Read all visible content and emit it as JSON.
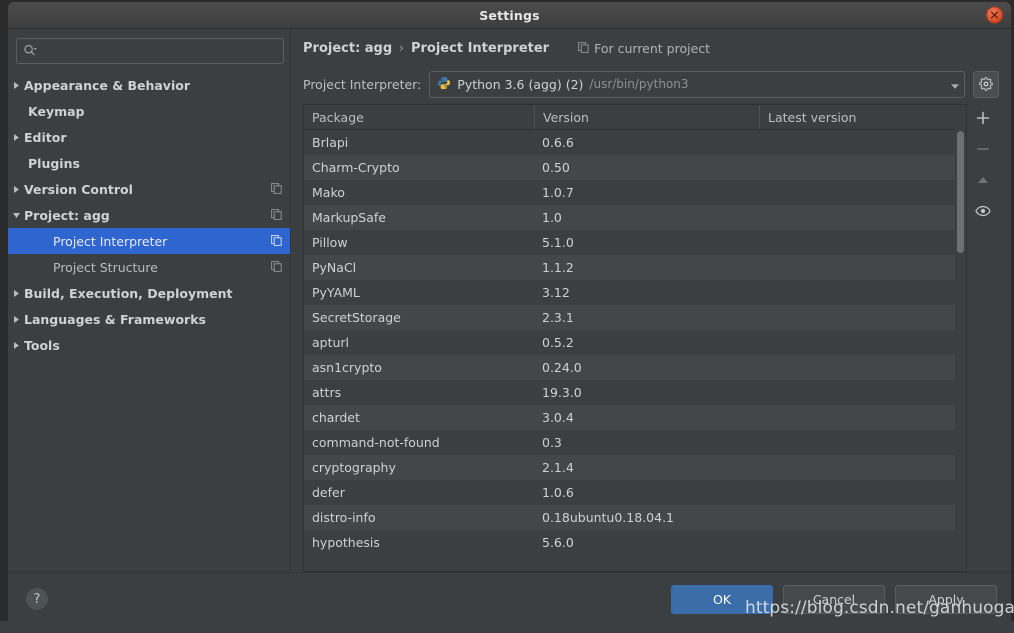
{
  "window": {
    "title": "Settings",
    "close_icon": "close-icon"
  },
  "sidebar": {
    "search": {
      "placeholder": "",
      "value": "",
      "icon": "search-icon"
    },
    "items": [
      {
        "label": "Appearance & Behavior",
        "arrow": "▶",
        "indent": 0,
        "bold": true,
        "selected": false,
        "copy": false
      },
      {
        "label": "Keymap",
        "arrow": "",
        "indent": 1,
        "bold": true,
        "selected": false,
        "copy": false
      },
      {
        "label": "Editor",
        "arrow": "▶",
        "indent": 0,
        "bold": true,
        "selected": false,
        "copy": false
      },
      {
        "label": "Plugins",
        "arrow": "",
        "indent": 1,
        "bold": true,
        "selected": false,
        "copy": false
      },
      {
        "label": "Version Control",
        "arrow": "▶",
        "indent": 0,
        "bold": true,
        "selected": false,
        "copy": true
      },
      {
        "label": "Project: agg",
        "arrow": "▼",
        "indent": 0,
        "bold": true,
        "selected": false,
        "copy": true
      },
      {
        "label": "Project Interpreter",
        "arrow": "",
        "indent": 2,
        "bold": false,
        "selected": true,
        "copy": true
      },
      {
        "label": "Project Structure",
        "arrow": "",
        "indent": 2,
        "bold": false,
        "selected": false,
        "copy": true
      },
      {
        "label": "Build, Execution, Deployment",
        "arrow": "▶",
        "indent": 0,
        "bold": true,
        "selected": false,
        "copy": false
      },
      {
        "label": "Languages & Frameworks",
        "arrow": "▶",
        "indent": 0,
        "bold": true,
        "selected": false,
        "copy": false
      },
      {
        "label": "Tools",
        "arrow": "▶",
        "indent": 0,
        "bold": true,
        "selected": false,
        "copy": false
      }
    ]
  },
  "main": {
    "breadcrumb": {
      "root": "Project: agg",
      "separator": "›",
      "current": "Project Interpreter"
    },
    "scope_note": {
      "label": "For current project",
      "icon": "copy-icon"
    },
    "interpreter": {
      "label": "Project Interpreter:",
      "icon": "python-icon",
      "name": "Python 3.6 (agg) (2)",
      "path": "/usr/bin/python3",
      "caret_icon": "chevron-down-icon",
      "settings_icon": "gear-icon"
    },
    "table": {
      "columns": [
        "Package",
        "Version",
        "Latest version"
      ],
      "rows": [
        {
          "package": "Brlapi",
          "version": "0.6.6",
          "latest": ""
        },
        {
          "package": "Charm-Crypto",
          "version": "0.50",
          "latest": ""
        },
        {
          "package": "Mako",
          "version": "1.0.7",
          "latest": ""
        },
        {
          "package": "MarkupSafe",
          "version": "1.0",
          "latest": ""
        },
        {
          "package": "Pillow",
          "version": "5.1.0",
          "latest": ""
        },
        {
          "package": "PyNaCl",
          "version": "1.1.2",
          "latest": ""
        },
        {
          "package": "PyYAML",
          "version": "3.12",
          "latest": ""
        },
        {
          "package": "SecretStorage",
          "version": "2.3.1",
          "latest": ""
        },
        {
          "package": "apturl",
          "version": "0.5.2",
          "latest": ""
        },
        {
          "package": "asn1crypto",
          "version": "0.24.0",
          "latest": ""
        },
        {
          "package": "attrs",
          "version": "19.3.0",
          "latest": ""
        },
        {
          "package": "chardet",
          "version": "3.0.4",
          "latest": ""
        },
        {
          "package": "command-not-found",
          "version": "0.3",
          "latest": ""
        },
        {
          "package": "cryptography",
          "version": "2.1.4",
          "latest": ""
        },
        {
          "package": "defer",
          "version": "1.0.6",
          "latest": ""
        },
        {
          "package": "distro-info",
          "version": "0.18ubuntu0.18.04.1",
          "latest": ""
        },
        {
          "package": "hypothesis",
          "version": "5.6.0",
          "latest": ""
        }
      ]
    },
    "tools": [
      {
        "name": "add-package-button",
        "icon": "plus-icon",
        "enabled": true
      },
      {
        "name": "remove-package-button",
        "icon": "minus-icon",
        "enabled": false
      },
      {
        "name": "upgrade-package-button",
        "icon": "arrow-up-icon",
        "enabled": false
      },
      {
        "name": "show-early-releases-button",
        "icon": "eye-icon",
        "enabled": true
      }
    ]
  },
  "footer": {
    "help_label": "?",
    "ok_label": "OK",
    "cancel_label": "Cancel",
    "apply_label": "Apply"
  },
  "watermark": {
    "text": "https://blog.csdn.net/ganhuoganhuo"
  },
  "colors": {
    "window_bg": "#3c3f41",
    "selection_blue": "#2f65ce",
    "primary_button": "#3b6ea8",
    "close_button": "#d64724",
    "row_alt": "#434749",
    "text": "#cfd2d3"
  }
}
